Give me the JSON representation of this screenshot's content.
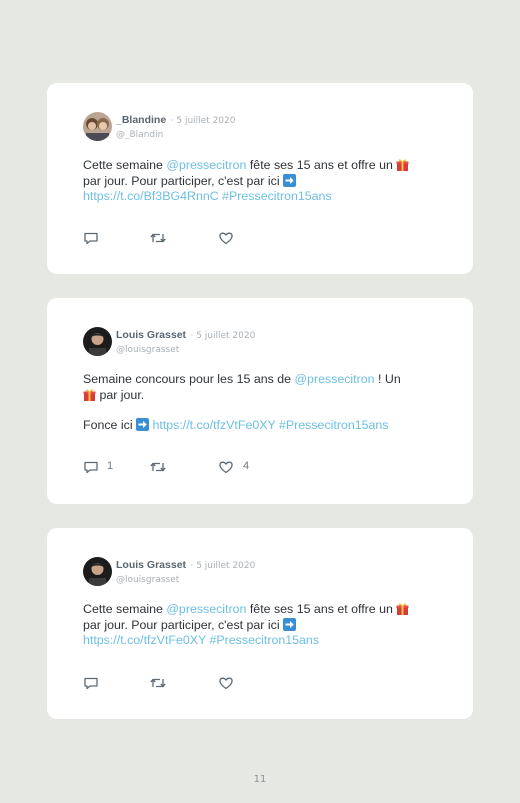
{
  "tweets": [
    {
      "author": "_Blandine",
      "date": "· 5 juillet 2020",
      "handle": "@_Blandin",
      "lines": {
        "l1a": "Cette semaine ",
        "mention": "@pressecitron",
        "l1b": " fête ses 15 ans et offre un ",
        "l2": "par jour. Pour participer, c'est par ici ",
        "url": "https://t.co/Bf3BG4RnnC",
        "hashtag": " #Pressecitron15ans"
      },
      "emojis": [
        "gift-emoji",
        "right-arrow-emoji"
      ],
      "replies": "",
      "likes": ""
    },
    {
      "author": "Louis Grasset",
      "date": "· 5 juillet 2020",
      "handle": "@louisgrasset",
      "lines": {
        "l1a": "Semaine concours pour les 15 ans de ",
        "mention": "@pressecitron",
        "l1b": " ! Un",
        "l2": " par jour.",
        "l3": "Fonce ici ",
        "url": "https://t.co/tfzVtFe0XY",
        "hashtag": " #Pressecitron15ans"
      },
      "emojis": [
        "gift-emoji",
        "right-arrow-emoji"
      ],
      "replies": "1",
      "likes": "4"
    },
    {
      "author": "Louis Grasset",
      "date": "· 5 juillet 2020",
      "handle": "@louisgrasset",
      "lines": {
        "l1a": "Cette semaine ",
        "mention": "@pressecitron",
        "l1b": " fête ses 15 ans et offre un ",
        "l2": "par jour. Pour participer, c'est par ici ",
        "url": "https://t.co/tfzVtFe0XY",
        "hashtag": " #Pressecitron15ans"
      },
      "emojis": [
        "gift-emoji",
        "right-arrow-emoji"
      ],
      "replies": "",
      "likes": ""
    }
  ],
  "icons": [
    "reply-icon",
    "retweet-icon",
    "like-icon"
  ],
  "colors": {
    "background": "#e6e9e3",
    "link": "#6cbfe3",
    "card": "#ffffff"
  },
  "page_number": "11"
}
